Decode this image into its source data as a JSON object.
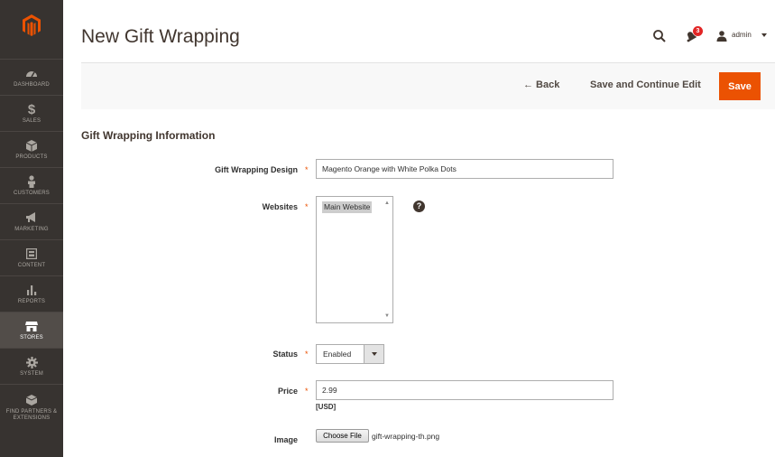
{
  "colors": {
    "sidebar_bg": "#373330",
    "accent": "#eb5202",
    "required_marker": "#eb5202",
    "notification": "#e22626"
  },
  "sidebar": {
    "logo_icon": "magento-logo-icon",
    "items": [
      {
        "label": "DASHBOARD",
        "icon": "dashboard-icon",
        "active": false
      },
      {
        "label": "SALES",
        "icon": "dollar-icon",
        "active": false
      },
      {
        "label": "PRODUCTS",
        "icon": "cube-icon",
        "active": false
      },
      {
        "label": "CUSTOMERS",
        "icon": "person-icon",
        "active": false
      },
      {
        "label": "MARKETING",
        "icon": "megaphone-icon",
        "active": false
      },
      {
        "label": "CONTENT",
        "icon": "content-icon",
        "active": false
      },
      {
        "label": "REPORTS",
        "icon": "bar-chart-icon",
        "active": false
      },
      {
        "label": "STORES",
        "icon": "store-icon",
        "active": true
      },
      {
        "label": "SYSTEM",
        "icon": "gear-icon",
        "active": false
      },
      {
        "label": "FIND PARTNERS & EXTENSIONS",
        "icon": "box-icon",
        "active": false
      }
    ]
  },
  "header": {
    "title": "New Gift Wrapping",
    "notification_count": "3",
    "user": "admin"
  },
  "actions": {
    "back_label": "← Back",
    "save_continue_label": "Save and Continue Edit",
    "save_label": "Save"
  },
  "form": {
    "section_title": "Gift Wrapping Information",
    "design": {
      "label": "Gift Wrapping Design",
      "value": "Magento Orange with White Polka Dots"
    },
    "websites": {
      "label": "Websites",
      "options": [
        "Main Website"
      ],
      "selected": "Main Website"
    },
    "status": {
      "label": "Status",
      "value": "Enabled"
    },
    "price": {
      "label": "Price",
      "value": "2.99",
      "currency": "[USD]"
    },
    "image": {
      "label": "Image",
      "button_label": "Choose File",
      "file_name": "gift-wrapping-th.png"
    },
    "required_marker": "*",
    "help_symbol": "?"
  }
}
